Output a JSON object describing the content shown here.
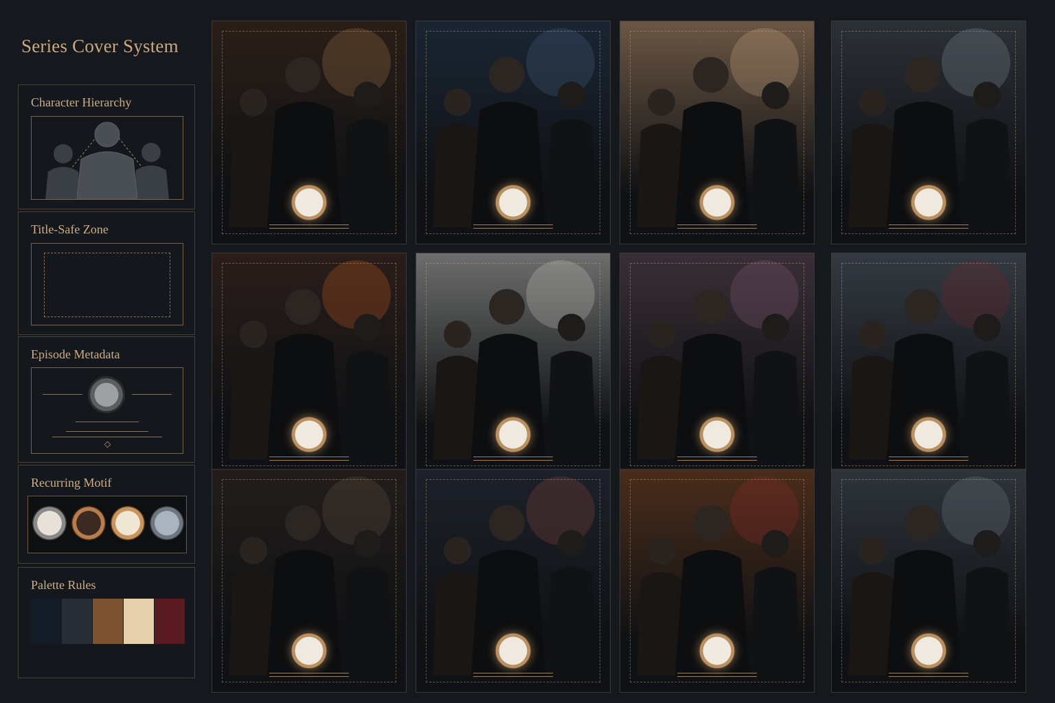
{
  "page_title": "Series Cover System",
  "panels": {
    "hierarchy": {
      "label": "Character Hierarchy"
    },
    "title_safe": {
      "label": "Title-Safe Zone"
    },
    "metadata": {
      "label": "Episode Metadata"
    },
    "motif": {
      "label": "Recurring Motif"
    },
    "palette": {
      "label": "Palette Rules"
    }
  },
  "palette_colors": [
    "#131b27",
    "#272d37",
    "#7a5230",
    "#e6cfac",
    "#5a1a22"
  ],
  "motif_watch_colors": [
    "#d9d4c8",
    "#3a2a22",
    "#e2d6bf",
    "#9eaab8"
  ],
  "covers": [
    {
      "scene": "chandelier-ballroom",
      "sky": "#2a1e17",
      "accent": "#b08050"
    },
    {
      "scene": "rainy-city-night",
      "sky": "#1a2533",
      "accent": "#4f6a8a"
    },
    {
      "scene": "sunlit-window",
      "sky": "#6b5644",
      "accent": "#d7b48c"
    },
    {
      "scene": "arched-window-gloom",
      "sky": "#2b3036",
      "accent": "#8e9aa6"
    },
    {
      "scene": "burning-fire",
      "sky": "#2a1d1a",
      "accent": "#d9641f"
    },
    {
      "scene": "white-flowers-storm",
      "sky": "#6c6d6c",
      "accent": "#d6d3cc"
    },
    {
      "scene": "dusk-skyline",
      "sky": "#3a2e37",
      "accent": "#8a6580"
    },
    {
      "scene": "ruined-columns-roses",
      "sky": "#343a42",
      "accent": "#7b2526"
    },
    {
      "scene": "window-blinds",
      "sky": "#221d1a",
      "accent": "#6a5747"
    },
    {
      "scene": "skyscraper-night",
      "sky": "#1c2029",
      "accent": "#9a4c3e"
    },
    {
      "scene": "candlelit-hall-petals",
      "sky": "#4a2c1b",
      "accent": "#9a2a2a"
    },
    {
      "scene": "stormy-sea",
      "sky": "#2e343b",
      "accent": "#7d8791"
    }
  ]
}
